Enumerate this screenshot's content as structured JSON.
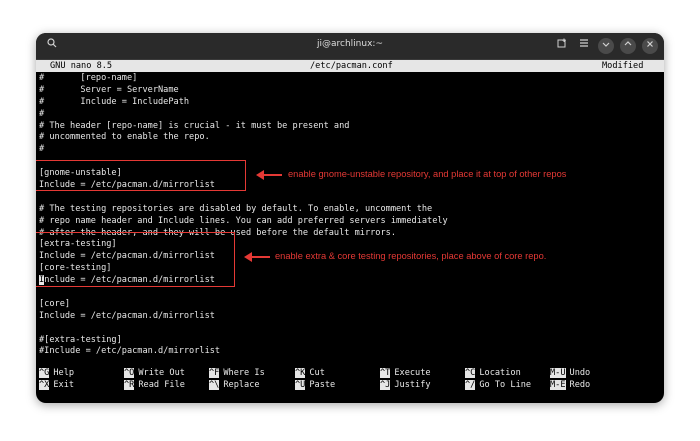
{
  "window": {
    "title": "ji@archlinux:~"
  },
  "nano": {
    "version": "GNU nano 8.5",
    "filename": "/etc/pacman.conf",
    "status": "Modified"
  },
  "lines": [
    "#       [repo-name]",
    "#       Server = ServerName",
    "#       Include = IncludePath",
    "#",
    "# The header [repo-name] is crucial - it must be present and",
    "# uncommented to enable the repo.",
    "#",
    "",
    "[gnome-unstable]",
    "Include = /etc/pacman.d/mirrorlist",
    "",
    "# The testing repositories are disabled by default. To enable, uncomment the",
    "# repo name header and Include lines. You can add preferred servers immediately",
    "# after the header, and they will be used before the default mirrors.",
    "[extra-testing]",
    "Include = /etc/pacman.d/mirrorlist",
    "[core-testing]",
    "Include = /etc/pacman.d/mirrorlist",
    "",
    "[core]",
    "Include = /etc/pacman.d/mirrorlist",
    "",
    "#[extra-testing]",
    "#Include = /etc/pacman.d/mirrorlist"
  ],
  "cursor_line": 17,
  "shortcuts": [
    [
      {
        "key": "^G",
        "label": "Help"
      },
      {
        "key": "^X",
        "label": "Exit"
      }
    ],
    [
      {
        "key": "^O",
        "label": "Write Out"
      },
      {
        "key": "^R",
        "label": "Read File"
      }
    ],
    [
      {
        "key": "^F",
        "label": "Where Is"
      },
      {
        "key": "^\\",
        "label": "Replace"
      }
    ],
    [
      {
        "key": "^K",
        "label": "Cut"
      },
      {
        "key": "^U",
        "label": "Paste"
      }
    ],
    [
      {
        "key": "^T",
        "label": "Execute"
      },
      {
        "key": "^J",
        "label": "Justify"
      }
    ],
    [
      {
        "key": "^C",
        "label": "Location"
      },
      {
        "key": "^/",
        "label": "Go To Line"
      }
    ],
    [
      {
        "key": "M-U",
        "label": "Undo"
      },
      {
        "key": "M-E",
        "label": "Redo"
      }
    ]
  ],
  "annotations": {
    "gnome": "enable gnome-unstable repository, and place it at top of other repos",
    "testing": "enable extra & core testing repositories, place above of core repo."
  },
  "colors": {
    "annotation": "#e53935",
    "terminal_bg": "#000000",
    "header_bg": "#e6e6e6"
  },
  "icons": [
    "search-icon",
    "new-tab-icon",
    "menu-icon",
    "minimize-icon",
    "maximize-icon",
    "close-icon"
  ]
}
